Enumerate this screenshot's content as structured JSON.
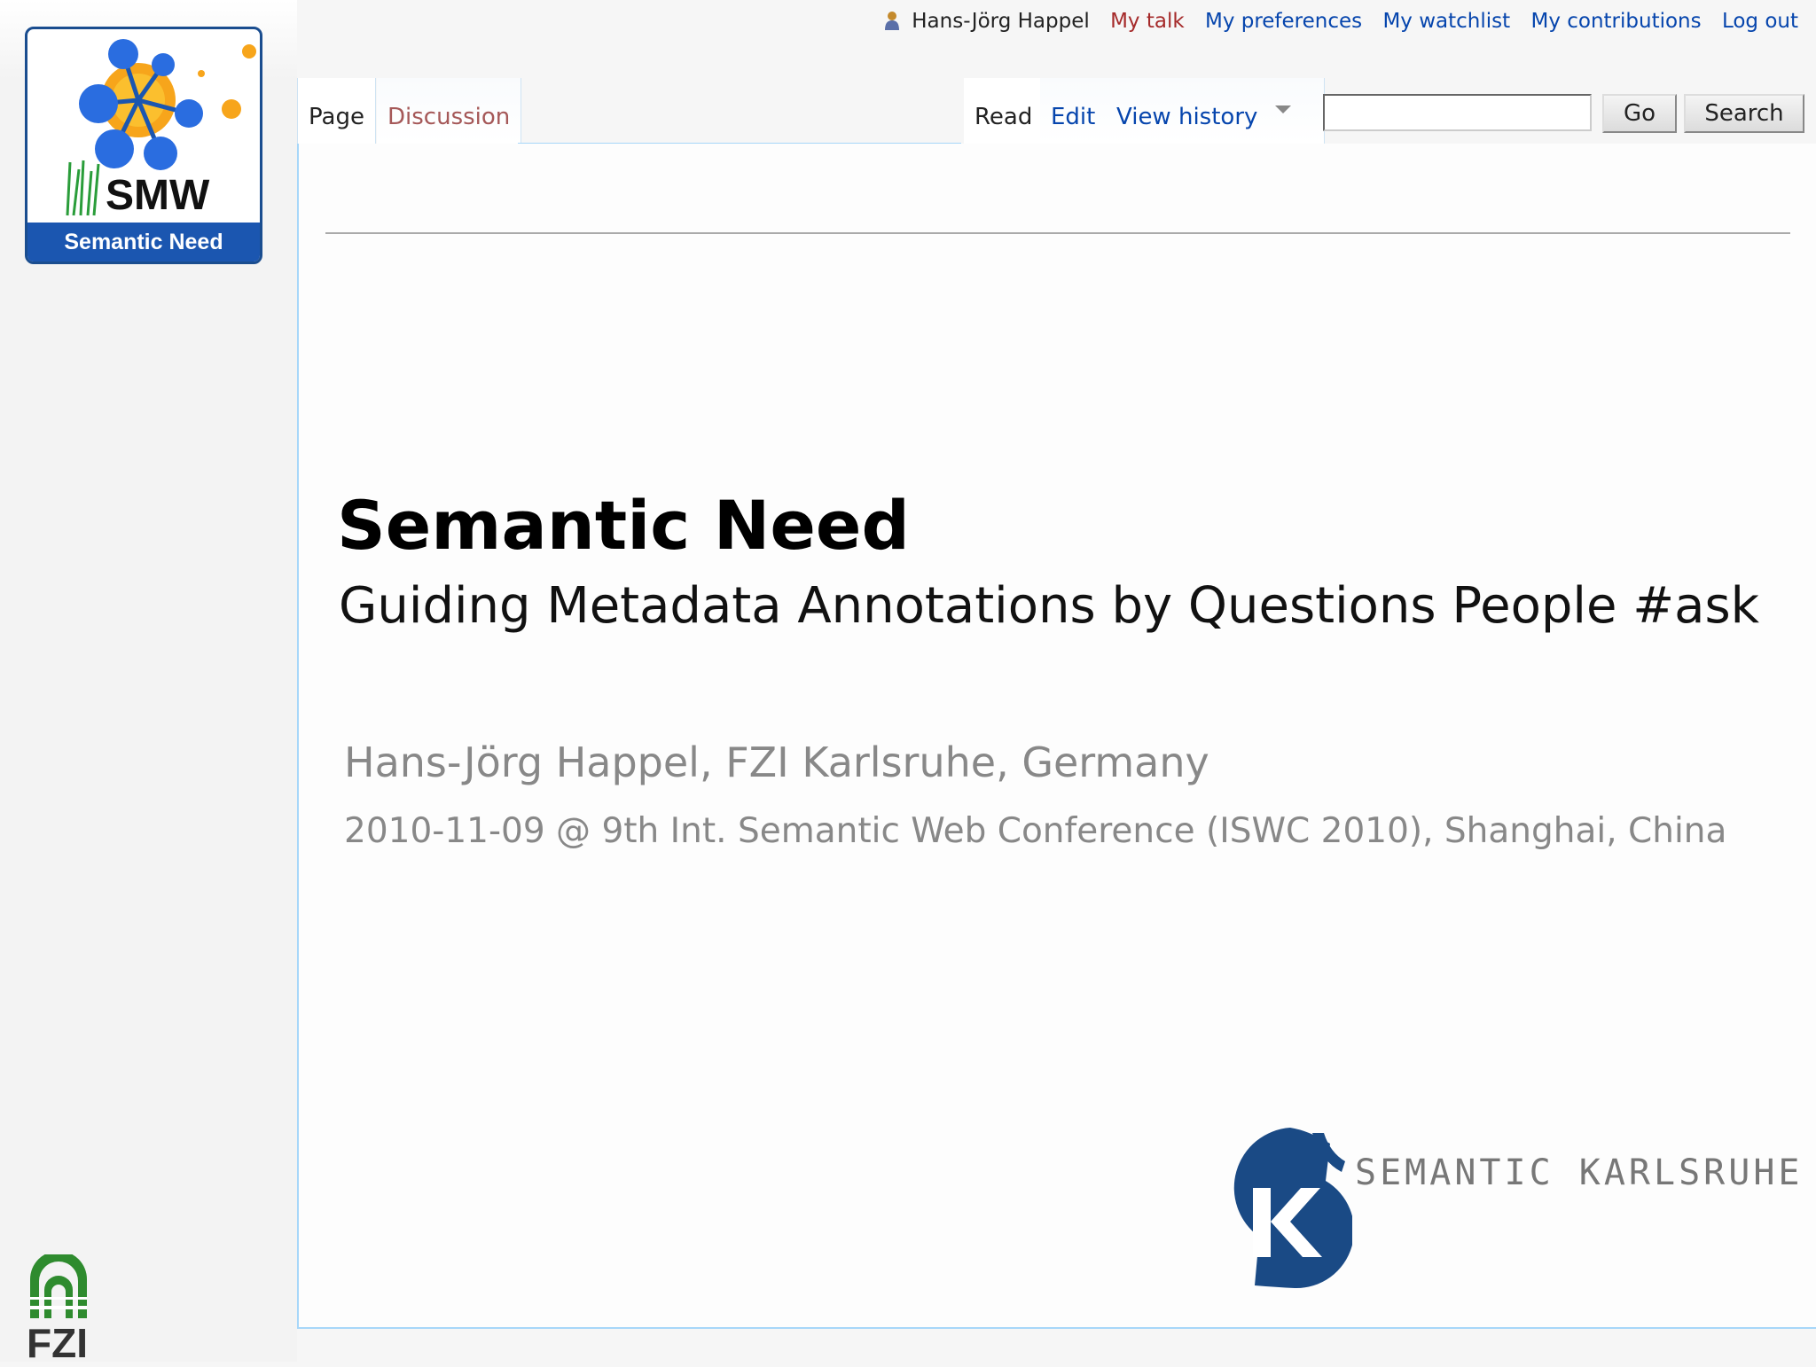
{
  "logo": {
    "mark": "SMW",
    "banner": "Semantic Need",
    "icon": "semantic-need-logo-icon"
  },
  "personal_tools": {
    "user_icon": "user-icon",
    "username": "Hans-Jörg Happel",
    "my_talk": "My talk",
    "my_preferences": "My preferences",
    "my_watchlist": "My watchlist",
    "my_contributions": "My contributions",
    "log_out": "Log out"
  },
  "tabs": {
    "page": "Page",
    "discussion": "Discussion",
    "read": "Read",
    "edit": "Edit",
    "view_history": "View history",
    "more_icon": "chevron-down-icon"
  },
  "search": {
    "value": "",
    "go_label": "Go",
    "search_label": "Search"
  },
  "slide": {
    "title": "Semantic Need",
    "subtitle": "Guiding Metadata Annotations by Questions People #ask",
    "author": "Hans-Jörg Happel, FZI Karlsruhe, Germany",
    "event": "2010-11-09 @ 9th Int. Semantic Web Conference (ISWC 2010), Shanghai, China"
  },
  "sponsor": {
    "name": "SEMANTIC KARLSRUHE",
    "icon": "semantic-karlsruhe-logo-icon"
  },
  "footer_logo": {
    "name": "FZI",
    "icon": "fzi-logo-icon"
  },
  "colors": {
    "link": "#0645ad",
    "new_link": "#a55858",
    "logo_blue": "#1b56b0",
    "tab_border": "#a7d7f9"
  }
}
